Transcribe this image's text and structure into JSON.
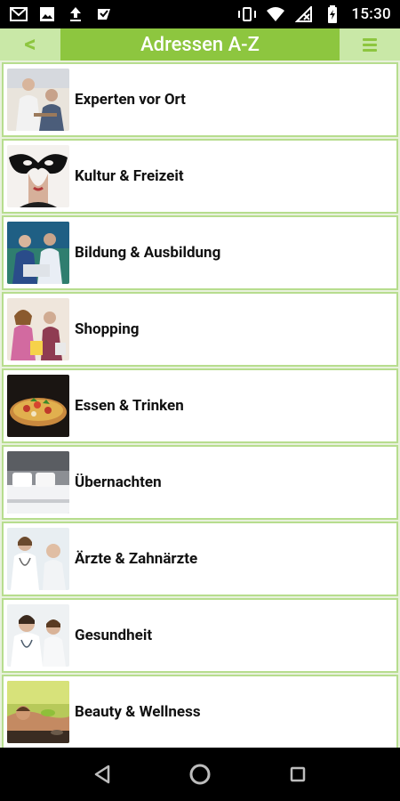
{
  "status_bar": {
    "time": "15:30"
  },
  "header": {
    "back_label": "<",
    "title": "Adressen A-Z"
  },
  "list": {
    "items": [
      {
        "label": "Experten vor Ort",
        "icon": "experts-photo"
      },
      {
        "label": "Kultur & Freizeit",
        "icon": "culture-mask-photo"
      },
      {
        "label": "Bildung & Ausbildung",
        "icon": "education-photo"
      },
      {
        "label": "Shopping",
        "icon": "shopping-photo"
      },
      {
        "label": "Essen & Trinken",
        "icon": "pizza-photo"
      },
      {
        "label": "Übernachten",
        "icon": "hotel-bed-photo"
      },
      {
        "label": "Ärzte & Zahnärzte",
        "icon": "doctors-photo"
      },
      {
        "label": "Gesundheit",
        "icon": "health-photo"
      },
      {
        "label": "Beauty & Wellness",
        "icon": "wellness-photo"
      }
    ]
  },
  "colors": {
    "accent": "#8dc63f",
    "accent_light": "#c9e8a7",
    "row_border": "#b7dd8e"
  }
}
